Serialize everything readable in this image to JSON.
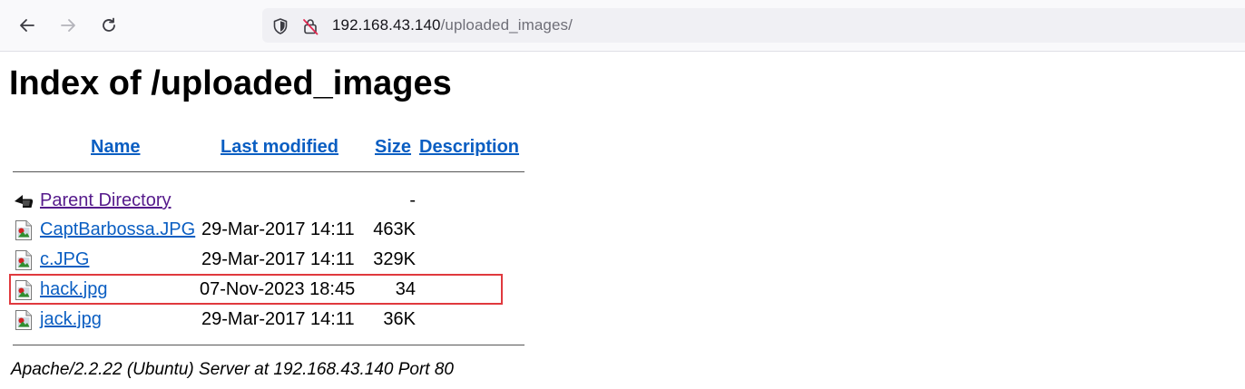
{
  "browser": {
    "url_host": "192.168.43.140",
    "url_path": "/uploaded_images/",
    "icons": {
      "back": "back-arrow-icon",
      "forward": "forward-arrow-icon",
      "reload": "reload-icon",
      "tracking": "shield-icon",
      "security": "insecure-lock-icon"
    }
  },
  "page": {
    "title": "Index of /uploaded_images",
    "columns": {
      "name": "Name",
      "last_modified": "Last modified",
      "size": "Size",
      "description": "Description"
    },
    "parent": {
      "label": "Parent Directory",
      "size": "-",
      "icon": "back-folder-icon"
    },
    "files": [
      {
        "name": "CaptBarbossa.JPG",
        "modified": "29-Mar-2017 14:11",
        "size": "463K",
        "icon": "image-file-icon"
      },
      {
        "name": "c.JPG",
        "modified": "29-Mar-2017 14:11",
        "size": "329K",
        "icon": "image-file-icon"
      },
      {
        "name": "hack.jpg",
        "modified": "07-Nov-2023 18:45",
        "size": "34",
        "icon": "image-file-icon",
        "highlighted": true
      },
      {
        "name": "jack.jpg",
        "modified": "29-Mar-2017 14:11",
        "size": "36K",
        "icon": "image-file-icon"
      }
    ],
    "footer": "Apache/2.2.22 (Ubuntu) Server at 192.168.43.140 Port 80"
  },
  "colors": {
    "link": "#0a5ec2",
    "visited_link": "#551a8b",
    "highlight_box": "#e0393e"
  }
}
